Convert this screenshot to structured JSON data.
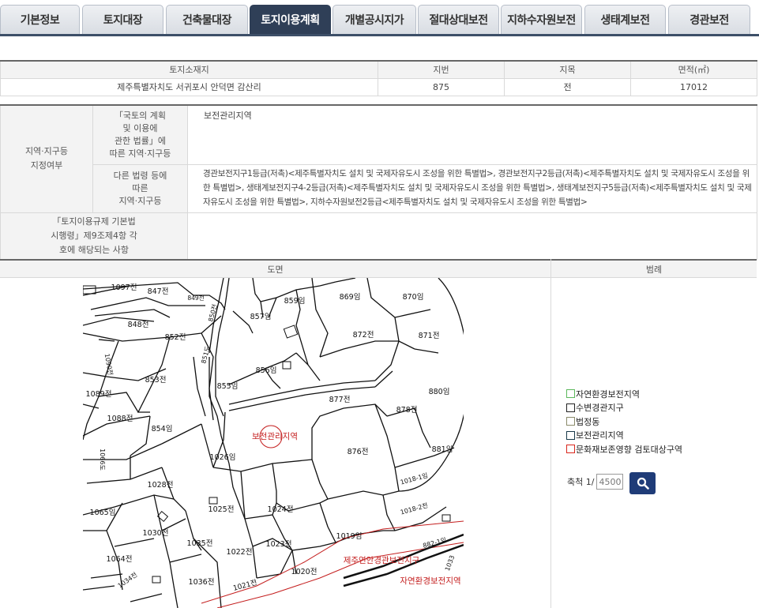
{
  "tabs": [
    {
      "label": "기본정보"
    },
    {
      "label": "토지대장"
    },
    {
      "label": "건축물대장"
    },
    {
      "label": "토지이용계획",
      "active": true
    },
    {
      "label": "개별공시지가"
    },
    {
      "label": "절대상대보전"
    },
    {
      "label": "지하수자원보전"
    },
    {
      "label": "생태계보전"
    },
    {
      "label": "경관보전"
    }
  ],
  "land": {
    "headers": {
      "location": "토지소재지",
      "lot": "지번",
      "category": "지목",
      "area": "면적(㎡)"
    },
    "location": "제주특별자치도 서귀포시 안덕면 감산리",
    "lot": "875",
    "category": "전",
    "area": "17012"
  },
  "zoning": {
    "section_label_1": "지역·지구등",
    "section_label_2": "지정여부",
    "national_law_l1": "「국토의 계획",
    "national_law_l2": "및 이용에",
    "national_law_l3": "관한 법률」에",
    "national_law_l4": "따른 지역·지구등",
    "national_value": "보전관리지역",
    "other_law_l1": "다른 법령 등에",
    "other_law_l2": "따른",
    "other_law_l3": "지역·지구등",
    "other_value": "경관보전지구1등급(저촉)<제주특별자치도 설치 및 국제자유도시 조성을 위한 특별법>, 경관보전지구2등급(저촉)<제주특별자치도 설치 및 국제자유도시 조성을 위한 특별법>, 생태계보전지구4-2등급(저촉)<제주특별자치도 설치 및 국제자유도시 조성을 위한 특별법>, 생태계보전지구5등급(저촉)<제주특별자치도 설치 및 국제자유도시 조성을 위한 특별법>, 지하수자원보전2등급<제주특별자치도 설치 및 국제자유도시 조성을 위한 특별법>",
    "regulation_l1": "「토지이용규제 기본법",
    "regulation_l2": "시행령」제9조제4항 각",
    "regulation_l3": "호에 해당되는 사항",
    "regulation_value": ""
  },
  "drawing": {
    "map_header": "도면",
    "legend_header": "범례",
    "parcels": [
      "1097전",
      "847전",
      "849전",
      "850전",
      "859임",
      "869임",
      "870임",
      "848전",
      "857임",
      "852전",
      "851도",
      "1090전",
      "872전",
      "871전",
      "853전",
      "856임",
      "1089전",
      "855임",
      "880임",
      "877전",
      "878전",
      "1088전",
      "854임",
      "보전관리지역",
      "1066도",
      "1026임",
      "876전",
      "881임",
      "1028전",
      "1018-1임",
      "1065임",
      "1025전",
      "1024전",
      "1018-2전",
      "1030전",
      "1019임",
      "882-1임",
      "1035전",
      "1022전",
      "1023전",
      "1064전",
      "1034전",
      "1036전",
      "1021전",
      "1020전",
      "1033",
      "제주연안경관보전지구",
      "자연환경보전지역"
    ],
    "legend": [
      {
        "label": "자연환경보전지역",
        "color": "#5cb85c"
      },
      {
        "label": "수변경관지구",
        "color": "#222222"
      },
      {
        "label": "법정동",
        "color": "#8a8a6a"
      },
      {
        "label": "보전관리지역",
        "color": "#1a3a4a"
      },
      {
        "label": "문화재보존영향 검토대상구역",
        "color": "#d9261c"
      }
    ],
    "scale_label": "축척 1/",
    "scale_value": "4500",
    "search_icon": "magnifier-icon"
  }
}
